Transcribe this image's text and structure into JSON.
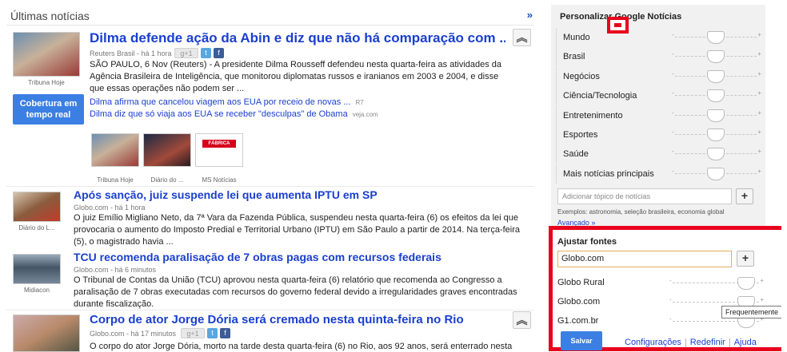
{
  "header": {
    "title": "Últimas notícias",
    "more": "»"
  },
  "stories": [
    {
      "headline": "Dilma defende ação da Abin e diz que não há comparação com ...",
      "meta": "Reuters Brasil - há 1 hora",
      "snippet": "SÃO PAULO, 6 Nov (Reuters) - A presidente Dilma Rousseff defendeu nesta quarta-feira as atividades da Agência Brasileira de Inteligência, que monitorou diplomatas russos e iranianos em 2003 e 2004, e disse que essas operações não podem ser ...",
      "thumb_caption": "Tribuna Hoje",
      "cta": "Cobertura em tempo real",
      "related": [
        {
          "text": "Dilma afirma que cancelou viagem aos EUA por receio de novas ...",
          "source": "R7"
        },
        {
          "text": "Dilma diz que só viaja aos EUA se receber \"desculpas\" de Obama",
          "source": "veja.com"
        }
      ],
      "gallery": [
        {
          "caption": "Tribuna Hoje"
        },
        {
          "caption": "Diário do ..."
        },
        {
          "caption": "MS Notícias",
          "logo": "FÁBRICA STAR"
        }
      ],
      "collapse": "︽"
    },
    {
      "headline": "Após sanção, juiz suspende lei que aumenta IPTU em SP",
      "meta": "Globo.com - há 1 hora",
      "snippet": "O juiz Emílio Migliano Neto, da 7ª Vara da Fazenda Pública, suspendeu nesta quarta-feira (6) os efeitos da lei que provocaria o aumento do Imposto Predial e Territorial Urbano (IPTU) em São Paulo a partir de 2014. Na terça-feira (5), o magistrado havia ...",
      "thumb_caption": "Diário do L..."
    },
    {
      "headline": "TCU recomenda paralisação de 7 obras pagas com recursos federais",
      "meta": "Globo.com - há 6 minutos",
      "snippet": "O Tribunal de Contas da União (TCU) aprovou nesta quarta-feira (6) relatório que recomenda ao Congresso a paralisação de 7 obras executadas com recursos do governo federal devido a irregularidades graves encontradas durante fiscalização.",
      "thumb_caption": "Midiacon"
    },
    {
      "headline": "Corpo de ator Jorge Dória será cremado nesta quinta-feira no Rio",
      "meta": "Globo.com - há 17 minutos",
      "snippet": "O corpo do ator Jorge Dória, morto na tarde desta quarta-feira (6) no Rio, aos 92 anos, será enterrado nesta",
      "collapse": "︽"
    }
  ],
  "share": {
    "g1": "g+1",
    "tw": "t",
    "fb": "f"
  },
  "sidebar": {
    "title": "Personalizar Google Notícias",
    "topics": [
      {
        "label": "Mundo",
        "level": 0.5
      },
      {
        "label": "Brasil",
        "level": 0.5
      },
      {
        "label": "Negócios",
        "level": 0.5
      },
      {
        "label": "Ciência/Tecnologia",
        "level": 0.5
      },
      {
        "label": "Entretenimento",
        "level": 0.5
      },
      {
        "label": "Esportes",
        "level": 0.5
      },
      {
        "label": "Saúde",
        "level": 0.5
      },
      {
        "label": "Mais notícias principais",
        "level": 0.5
      }
    ],
    "slider_minus": "-",
    "slider_plus": "+",
    "add_topic_placeholder": "Adicionar tópico de notícias",
    "add_button": "+",
    "examples": "Exemplos: astronomia, seleção brasileira, economia global",
    "advanced": "Avançado »"
  },
  "sources": {
    "title": "Ajustar fontes",
    "input_value": "Globo.com",
    "add_button": "+",
    "items": [
      {
        "label": "Globo Rural",
        "level": 0.85
      },
      {
        "label": "Globo.com",
        "level": 0.85
      },
      {
        "label": "G1.com.br",
        "level": 0.85
      }
    ],
    "tooltip": "Frequentemente",
    "save": "Salvar",
    "links": [
      "Configurações",
      "Redefinir",
      "Ajuda"
    ]
  },
  "colors": {
    "accent": "#3b7fe3",
    "link": "#1a3fcf",
    "highlight": "#e8001c"
  }
}
